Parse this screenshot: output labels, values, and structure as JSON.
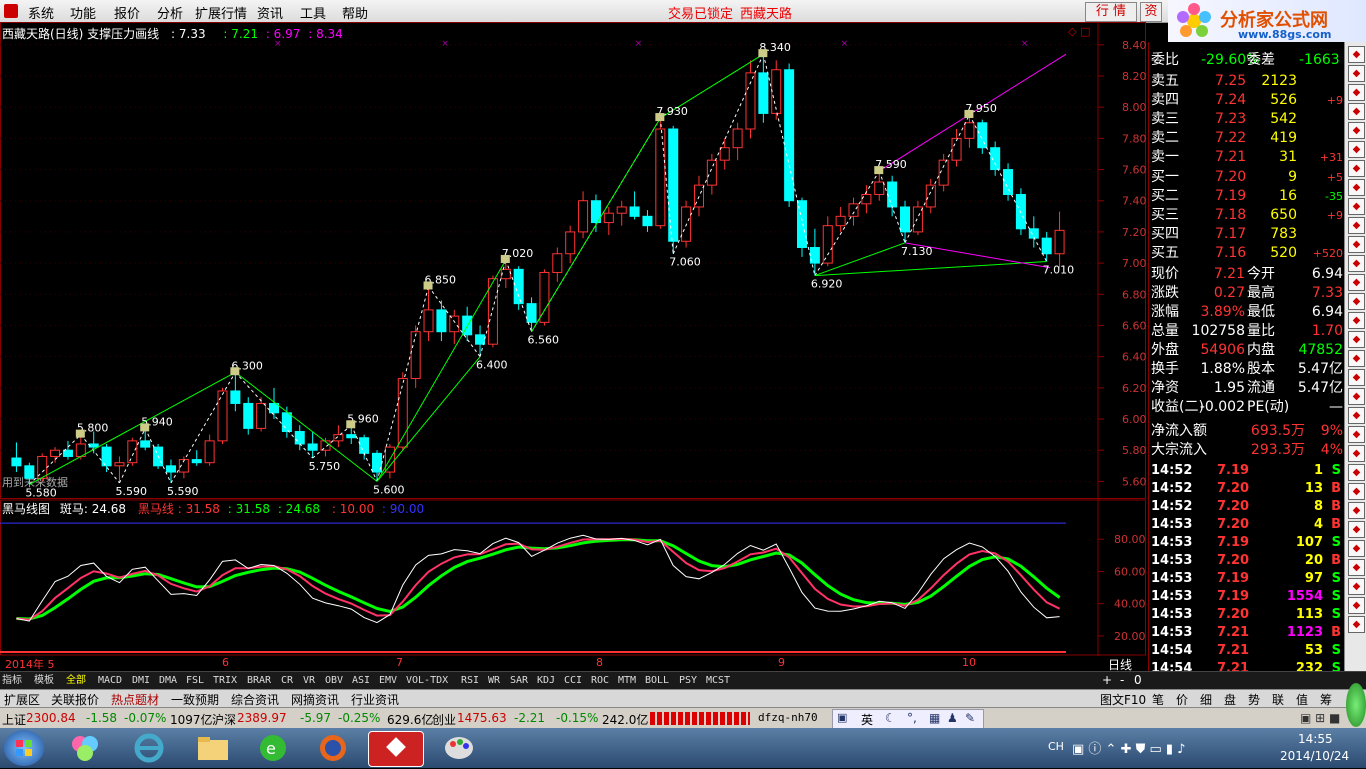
{
  "menu": {
    "items": [
      "系统",
      "功能",
      "报价",
      "分析",
      "扩展行情",
      "资讯",
      "工具",
      "帮助"
    ],
    "lock_status": "交易已锁定",
    "stock_name": "西藏天路",
    "btn_trade": "行 情",
    "btn_info": "资",
    "logo_text": "分析家公式网",
    "logo_url": "www.88gs.com"
  },
  "chart": {
    "title": "西藏天路(日线) 支撑压力画线",
    "title_val1": ": 7.33",
    "title_val2": ": 7.21",
    "title_val3": ": 6.97",
    "title_val4": ": 8.34",
    "note": "用到未来数据",
    "y_ticks": [
      "8.40",
      "8.20",
      "8.00",
      "7.80",
      "7.60",
      "7.40",
      "7.20",
      "7.00",
      "6.80",
      "6.60",
      "6.40",
      "6.20",
      "6.00",
      "5.80",
      "5.60"
    ],
    "annotations": [
      "5.580",
      "5.800",
      "5.590",
      "5.940",
      "5.590",
      "6.300",
      "5.750",
      "5.960",
      "5.600",
      "6.850",
      "6.400",
      "7.020",
      "6.560",
      "7.930",
      "7.060",
      "8.340",
      "6.920",
      "7.590",
      "7.130",
      "7.950",
      "7.010"
    ]
  },
  "chart_data": {
    "type": "candlestick",
    "title": "西藏天路(日线)",
    "ylim": [
      5.5,
      8.45
    ],
    "x_month_labels": [
      "2014年 5",
      "6",
      "7",
      "8",
      "9",
      "10"
    ],
    "candles_ohlc": [
      [
        5.75,
        5.85,
        5.66,
        5.7
      ],
      [
        5.7,
        5.72,
        5.58,
        5.62
      ],
      [
        5.62,
        5.78,
        5.6,
        5.76
      ],
      [
        5.76,
        5.82,
        5.72,
        5.8
      ],
      [
        5.8,
        5.86,
        5.74,
        5.76
      ],
      [
        5.76,
        5.9,
        5.74,
        5.84
      ],
      [
        5.84,
        5.92,
        5.78,
        5.82
      ],
      [
        5.82,
        5.84,
        5.66,
        5.7
      ],
      [
        5.7,
        5.76,
        5.59,
        5.72
      ],
      [
        5.72,
        5.88,
        5.7,
        5.86
      ],
      [
        5.86,
        5.94,
        5.8,
        5.82
      ],
      [
        5.82,
        5.84,
        5.68,
        5.7
      ],
      [
        5.7,
        5.74,
        5.59,
        5.66
      ],
      [
        5.66,
        5.76,
        5.62,
        5.74
      ],
      [
        5.74,
        5.8,
        5.7,
        5.72
      ],
      [
        5.72,
        5.9,
        5.7,
        5.86
      ],
      [
        5.86,
        6.2,
        5.84,
        6.18
      ],
      [
        6.18,
        6.3,
        6.05,
        6.1
      ],
      [
        6.1,
        6.14,
        5.9,
        5.94
      ],
      [
        5.94,
        6.14,
        5.92,
        6.1
      ],
      [
        6.1,
        6.2,
        6.0,
        6.04
      ],
      [
        6.04,
        6.08,
        5.88,
        5.92
      ],
      [
        5.92,
        5.96,
        5.8,
        5.84
      ],
      [
        5.84,
        5.92,
        5.75,
        5.8
      ],
      [
        5.8,
        5.88,
        5.76,
        5.86
      ],
      [
        5.86,
        5.96,
        5.82,
        5.9
      ],
      [
        5.9,
        5.96,
        5.84,
        5.88
      ],
      [
        5.88,
        5.9,
        5.74,
        5.78
      ],
      [
        5.78,
        5.8,
        5.6,
        5.66
      ],
      [
        5.66,
        5.84,
        5.62,
        5.82
      ],
      [
        5.82,
        6.3,
        5.8,
        6.26
      ],
      [
        6.26,
        6.6,
        6.2,
        6.56
      ],
      [
        6.56,
        6.85,
        6.5,
        6.7
      ],
      [
        6.7,
        6.76,
        6.5,
        6.56
      ],
      [
        6.56,
        6.7,
        6.48,
        6.66
      ],
      [
        6.66,
        6.72,
        6.5,
        6.54
      ],
      [
        6.54,
        6.6,
        6.4,
        6.48
      ],
      [
        6.48,
        6.92,
        6.46,
        6.9
      ],
      [
        6.9,
        7.02,
        6.84,
        6.96
      ],
      [
        6.96,
        6.98,
        6.7,
        6.74
      ],
      [
        6.74,
        6.78,
        6.56,
        6.62
      ],
      [
        6.62,
        6.96,
        6.6,
        6.94
      ],
      [
        6.94,
        7.1,
        6.88,
        7.06
      ],
      [
        7.06,
        7.24,
        7.0,
        7.2
      ],
      [
        7.2,
        7.46,
        7.16,
        7.4
      ],
      [
        7.4,
        7.44,
        7.2,
        7.26
      ],
      [
        7.26,
        7.36,
        7.18,
        7.32
      ],
      [
        7.32,
        7.4,
        7.24,
        7.36
      ],
      [
        7.36,
        7.46,
        7.28,
        7.3
      ],
      [
        7.3,
        7.34,
        7.2,
        7.24
      ],
      [
        7.24,
        7.93,
        7.22,
        7.86
      ],
      [
        7.86,
        7.88,
        7.06,
        7.14
      ],
      [
        7.14,
        7.4,
        7.1,
        7.36
      ],
      [
        7.36,
        7.56,
        7.3,
        7.5
      ],
      [
        7.5,
        7.7,
        7.44,
        7.66
      ],
      [
        7.66,
        7.8,
        7.6,
        7.74
      ],
      [
        7.74,
        7.9,
        7.66,
        7.86
      ],
      [
        7.86,
        8.3,
        7.8,
        8.22
      ],
      [
        8.22,
        8.34,
        7.9,
        7.96
      ],
      [
        7.96,
        8.3,
        7.92,
        8.24
      ],
      [
        8.24,
        8.28,
        7.36,
        7.4
      ],
      [
        7.4,
        7.42,
        7.04,
        7.1
      ],
      [
        7.1,
        7.22,
        6.92,
        7.0
      ],
      [
        7.0,
        7.3,
        6.98,
        7.24
      ],
      [
        7.24,
        7.36,
        7.2,
        7.3
      ],
      [
        7.3,
        7.42,
        7.24,
        7.38
      ],
      [
        7.38,
        7.5,
        7.32,
        7.44
      ],
      [
        7.44,
        7.59,
        7.4,
        7.52
      ],
      [
        7.52,
        7.56,
        7.3,
        7.36
      ],
      [
        7.36,
        7.4,
        7.13,
        7.2
      ],
      [
        7.2,
        7.4,
        7.18,
        7.36
      ],
      [
        7.36,
        7.54,
        7.32,
        7.5
      ],
      [
        7.5,
        7.7,
        7.46,
        7.66
      ],
      [
        7.66,
        7.86,
        7.62,
        7.8
      ],
      [
        7.8,
        7.95,
        7.74,
        7.9
      ],
      [
        7.9,
        7.92,
        7.7,
        7.74
      ],
      [
        7.74,
        7.78,
        7.56,
        7.6
      ],
      [
        7.6,
        7.64,
        7.4,
        7.44
      ],
      [
        7.44,
        7.48,
        7.18,
        7.22
      ],
      [
        7.22,
        7.3,
        7.1,
        7.16
      ],
      [
        7.16,
        7.2,
        7.01,
        7.06
      ],
      [
        7.06,
        7.33,
        6.97,
        7.21
      ]
    ],
    "indicator": {
      "name": "黑马线图",
      "series": [
        {
          "name": "斑马",
          "last": 24.68
        },
        {
          "name": "黑马线",
          "last": 31.58
        },
        {
          "name": "",
          "last": 31.58
        },
        {
          "name": "",
          "last": 24.68
        }
      ],
      "ref_lines": [
        10.0,
        90.0
      ],
      "y_ticks": [
        "80.00",
        "60.00",
        "40.00",
        "20.00"
      ],
      "ylim": [
        10,
        100
      ]
    }
  },
  "indicator_header": {
    "name": "黑马线图",
    "zebra_label": "斑马: 24.68",
    "hm_label": "黑马线",
    "v1": ": 31.58",
    "v2": ": 31.58",
    "v3": ": 24.68",
    "v4": ": 10.00",
    "v5": ": 90.00"
  },
  "quote": {
    "wei_bi_label": "委比",
    "wei_bi": "-29.60%",
    "wei_cha_label": "委差",
    "wei_cha": "-1663",
    "asks": [
      {
        "label": "卖五",
        "price": "7.25",
        "vol": "2123",
        "chg": ""
      },
      {
        "label": "卖四",
        "price": "7.24",
        "vol": "526",
        "chg": "+9"
      },
      {
        "label": "卖三",
        "price": "7.23",
        "vol": "542",
        "chg": ""
      },
      {
        "label": "卖二",
        "price": "7.22",
        "vol": "419",
        "chg": ""
      },
      {
        "label": "卖一",
        "price": "7.21",
        "vol": "31",
        "chg": "+31"
      }
    ],
    "bids": [
      {
        "label": "买一",
        "price": "7.20",
        "vol": "9",
        "chg": "+5"
      },
      {
        "label": "买二",
        "price": "7.19",
        "vol": "16",
        "chg": "-35"
      },
      {
        "label": "买三",
        "price": "7.18",
        "vol": "650",
        "chg": "+9"
      },
      {
        "label": "买四",
        "price": "7.17",
        "vol": "783",
        "chg": ""
      },
      {
        "label": "买五",
        "price": "7.16",
        "vol": "520",
        "chg": "+520"
      }
    ],
    "stats": [
      {
        "l1": "现价",
        "v1": "7.21",
        "l2": "今开",
        "v2": "6.94"
      },
      {
        "l1": "涨跌",
        "v1": "0.27",
        "l2": "最高",
        "v2": "7.33"
      },
      {
        "l1": "涨幅",
        "v1": "3.89%",
        "l2": "最低",
        "v2": "6.94"
      },
      {
        "l1": "总量",
        "v1": "102758",
        "l2": "量比",
        "v2": "1.70"
      },
      {
        "l1": "外盘",
        "v1": "54906",
        "l2": "内盘",
        "v2": "47852"
      },
      {
        "l1": "换手",
        "v1": "1.88%",
        "l2": "股本",
        "v2": "5.47亿"
      },
      {
        "l1": "净资",
        "v1": "1.95",
        "l2": "流通",
        "v2": "5.47亿"
      },
      {
        "l1": "收益(二)",
        "v1": "-0.002",
        "l2": "PE(动)",
        "v2": "—"
      }
    ],
    "flow": [
      {
        "label": "净流入额",
        "value": "693.5万",
        "pct": "9%"
      },
      {
        "label": "大宗流入",
        "value": "293.3万",
        "pct": "4%"
      }
    ],
    "ticks": [
      {
        "time": "14:52",
        "price": "7.19",
        "vol": "1",
        "side": "S"
      },
      {
        "time": "14:52",
        "price": "7.20",
        "vol": "13",
        "side": "B"
      },
      {
        "time": "14:52",
        "price": "7.20",
        "vol": "8",
        "side": "B"
      },
      {
        "time": "14:53",
        "price": "7.20",
        "vol": "4",
        "side": "B"
      },
      {
        "time": "14:53",
        "price": "7.19",
        "vol": "107",
        "side": "S"
      },
      {
        "time": "14:53",
        "price": "7.20",
        "vol": "20",
        "side": "B"
      },
      {
        "time": "14:53",
        "price": "7.19",
        "vol": "97",
        "side": "S"
      },
      {
        "time": "14:53",
        "price": "7.19",
        "vol": "1554",
        "side": "S"
      },
      {
        "time": "14:53",
        "price": "7.20",
        "vol": "113",
        "side": "S"
      },
      {
        "time": "14:53",
        "price": "7.21",
        "vol": "1123",
        "side": "B"
      },
      {
        "time": "14:54",
        "price": "7.21",
        "vol": "53",
        "side": "S"
      },
      {
        "time": "14:54",
        "price": "7.21",
        "vol": "232",
        "side": "S"
      }
    ]
  },
  "xaxis": {
    "labels": [
      "2014年 5",
      "6",
      "7",
      "8",
      "9",
      "10"
    ],
    "period": "日线"
  },
  "indicator_tabs": [
    "指标",
    "模板",
    "全部",
    "MACD",
    "DMI",
    "DMA",
    "FSL",
    "TRIX",
    "BRAR",
    "CR",
    "VR",
    "OBV",
    "ASI",
    "EMV",
    "VOL-TDX",
    "RSI",
    "WR",
    "SAR",
    "KDJ",
    "CCI",
    "ROC",
    "MTM",
    "BOLL",
    "PSY",
    "MCST"
  ],
  "nav_buttons": [
    "+",
    "-",
    "0"
  ],
  "info_tabs": [
    "扩展区",
    "关联报价",
    "热点题材",
    "一致预期",
    "综合资讯",
    "网摘资讯",
    "行业资讯"
  ],
  "right_tabs": [
    "图文F10",
    "笔",
    "价",
    "细",
    "盘",
    "势",
    "联",
    "值",
    "筹"
  ],
  "status": {
    "sh_label": "上证",
    "sh": "2300.84",
    "sh_chg": "-1.58",
    "sh_pct": "-0.07%",
    "sh_amt": "1097亿",
    "sz_label": "沪深",
    "sz": "2389.97",
    "sz_chg": "-5.97",
    "sz_pct": "-0.25%",
    "sz_amt": "629.6亿",
    "cy_label": "创业",
    "cy": "1475.63",
    "cy_chg": "-2.21",
    "cy_pct": "-0.15%",
    "cy_amt": "242.0亿",
    "server": "dfzq-nh70",
    "ime": "英"
  },
  "taskbar": {
    "lang": "CH",
    "time": "14:55",
    "date": "2014/10/24"
  },
  "colors": {
    "up": "#ff3333",
    "down": "#00ffff",
    "bg": "#000000",
    "grid": "#800000",
    "support": "#00ff00",
    "resist": "#ff00ff"
  }
}
